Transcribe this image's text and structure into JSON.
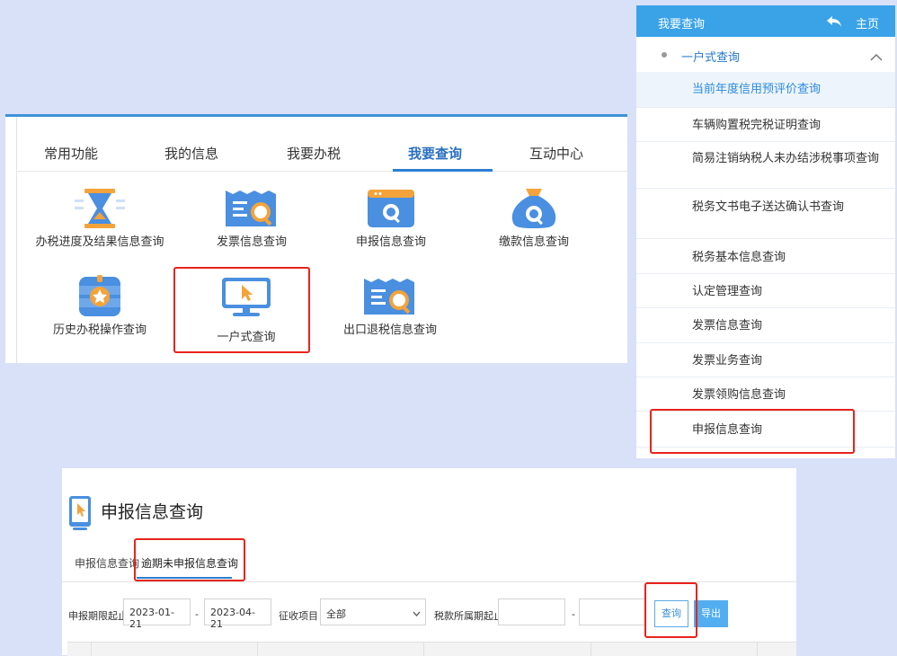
{
  "func_panel": {
    "tabs": [
      "常用功能",
      "我的信息",
      "我要办税",
      "我要查询",
      "互动中心"
    ],
    "active_tab": "我要查询",
    "tiles": [
      {
        "label": "办税进度及结果信息查询",
        "icon": "hourglass-icon"
      },
      {
        "label": "发票信息查询",
        "icon": "invoice-search-icon"
      },
      {
        "label": "申报信息查询",
        "icon": "browser-search-icon"
      },
      {
        "label": "缴款信息查询",
        "icon": "money-bag-search-icon"
      },
      {
        "label": "历史办税操作查询",
        "icon": "history-badge-icon"
      },
      {
        "label": "一户式查询",
        "icon": "monitor-cursor-icon"
      },
      {
        "label": "出口退税信息查询",
        "icon": "export-refund-icon"
      }
    ],
    "highlight_color": "#e8231c",
    "accent_color": "#2b7fd4"
  },
  "side_menu": {
    "title": "我要查询",
    "home_label": "主页",
    "section": "一户式查询",
    "items": [
      "当前年度信用预评价查询",
      "车辆购置税完税证明查询",
      "简易注销纳税人未办结涉税事项查询",
      "税务文书电子送达确认书查询",
      "税务基本信息查询",
      "认定管理查询",
      "发票信息查询",
      "发票业务查询",
      "发票领购信息查询",
      "申报信息查询"
    ],
    "selected_item": "当前年度信用预评价查询",
    "header_color": "#3aa3e8"
  },
  "query_page": {
    "title": "申报信息查询",
    "subtabs": [
      "申报信息查询",
      "逾期未申报信息查询"
    ],
    "active_subtab": "逾期未申报信息查询",
    "filters": {
      "period_label": "申报期限起止：",
      "period_start": "2023-01-21",
      "period_end": "2023-04-21",
      "dash": "-",
      "levy_label": "征收项目：",
      "levy_value": "全部",
      "tax_period_label": "税款所属期起止：",
      "tax_period_start": "",
      "tax_period_end": ""
    },
    "query_button": "查询",
    "export_button": "导出"
  }
}
